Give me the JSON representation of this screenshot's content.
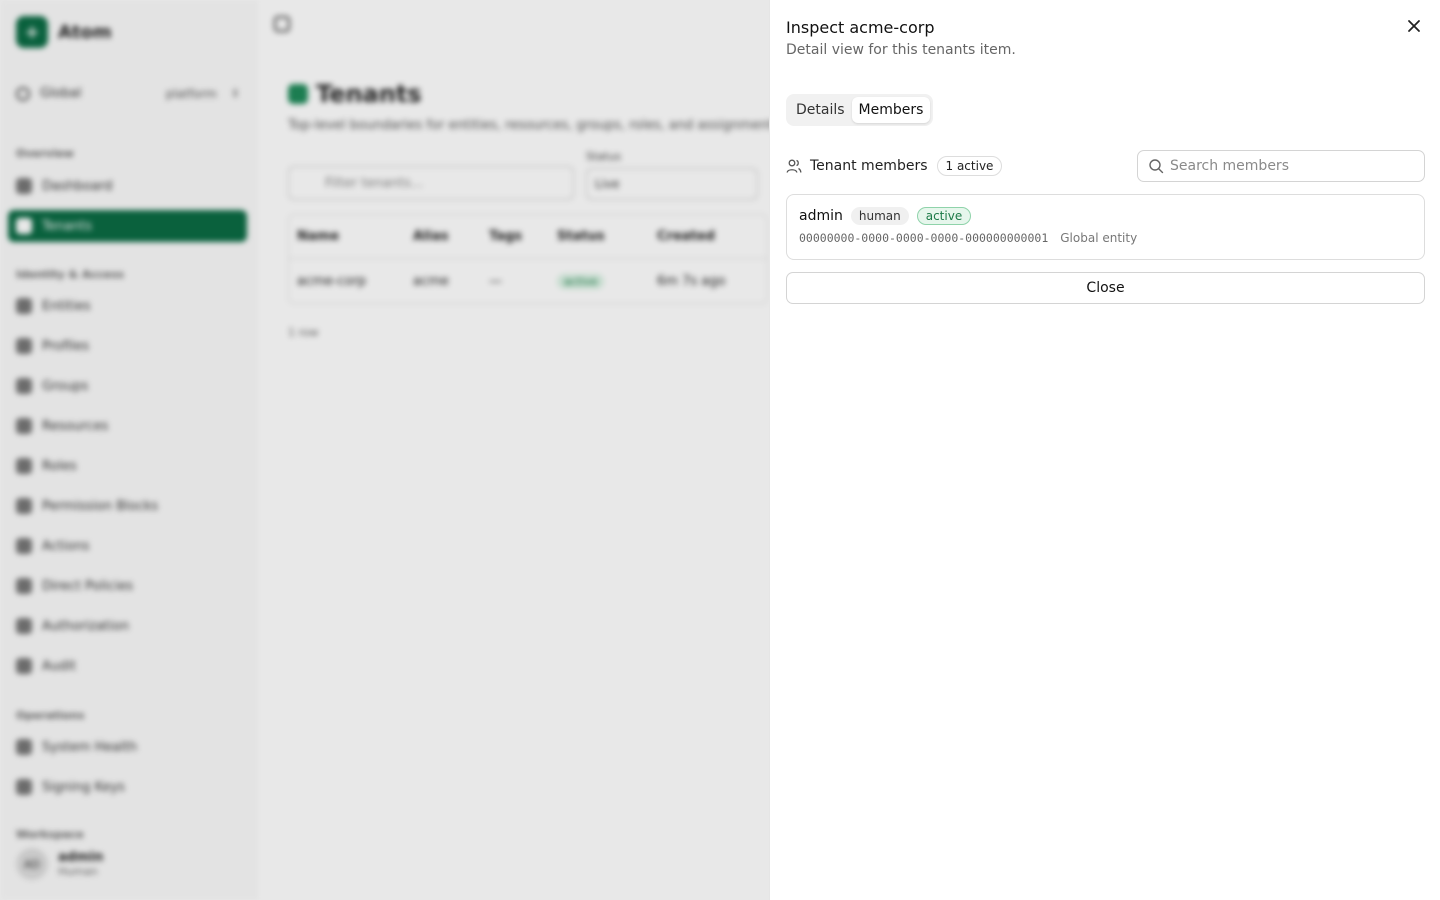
{
  "app": {
    "brand": "Atom",
    "scope": {
      "name": "Global",
      "sub": "platform"
    },
    "nav_sections": [
      "Overview",
      "Identity & Access",
      "Operations",
      "Workspace"
    ],
    "nav_items": [
      "Dashboard",
      "Tenants",
      "Entities",
      "Profiles",
      "Groups",
      "Resources",
      "Roles",
      "Permission Blocks",
      "Actions",
      "Direct Policies",
      "Authorization",
      "Audit",
      "System Health",
      "Signing Keys"
    ],
    "user": {
      "initials": "AD",
      "name": "admin",
      "role": "Human"
    }
  },
  "main": {
    "title": "Tenants",
    "subtitle": "Top-level boundaries for entities, resources, groups, roles, and assignments.",
    "filter_placeholder": "Filter tenants...",
    "status_label": "Status",
    "status_value": "Live",
    "table": {
      "headers": [
        "Name",
        "Alias",
        "Tags",
        "Status",
        "Created"
      ],
      "rows": [
        [
          "acme-corp",
          "acme",
          "—",
          "active",
          "6m 7s ago"
        ]
      ]
    },
    "row_count": "1 row"
  },
  "panel": {
    "title": "Inspect acme-corp",
    "subtitle": "Detail view for this tenants item.",
    "tabs": [
      "Details",
      "Members"
    ],
    "active_tab": "Members",
    "members": {
      "label": "Tenant members",
      "count_badge": "1 active",
      "search_placeholder": "Search members",
      "items": [
        {
          "name": "admin",
          "type": "human",
          "status": "active",
          "id": "00000000-0000-0000-0000-000000000001",
          "scope": "Global entity"
        }
      ]
    },
    "close_label": "Close"
  },
  "colors": {
    "accent": "#0b6b44",
    "status_active_bg": "#e6f6ec",
    "status_active_text": "#1c7a47"
  },
  "icons": [
    "close-icon",
    "users-icon",
    "search-icon"
  ]
}
